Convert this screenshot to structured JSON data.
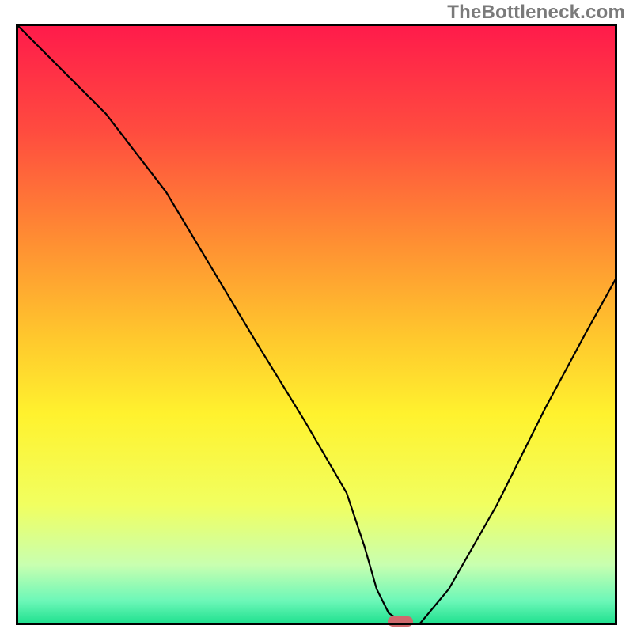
{
  "watermark": "TheBottleneck.com",
  "chart_data": {
    "type": "line",
    "title": "",
    "xlabel": "",
    "ylabel": "",
    "xlim": [
      0,
      100
    ],
    "ylim": [
      0,
      100
    ],
    "grid": false,
    "legend": false,
    "background": {
      "type": "vertical-gradient",
      "stops": [
        {
          "pos": 0,
          "color": "#ff1a4b"
        },
        {
          "pos": 18,
          "color": "#ff4c3f"
        },
        {
          "pos": 35,
          "color": "#ff8a33"
        },
        {
          "pos": 52,
          "color": "#ffc72d"
        },
        {
          "pos": 65,
          "color": "#fff22e"
        },
        {
          "pos": 80,
          "color": "#f1ff60"
        },
        {
          "pos": 90,
          "color": "#c8ffb0"
        },
        {
          "pos": 96,
          "color": "#6cf7b8"
        },
        {
          "pos": 100,
          "color": "#1adf8c"
        }
      ]
    },
    "series": [
      {
        "name": "bottleneck-curve",
        "color": "#000000",
        "x": [
          0,
          7,
          15,
          25,
          31,
          40,
          48,
          55,
          58,
          60,
          62,
          65,
          67,
          72,
          80,
          88,
          95,
          100
        ],
        "values": [
          100,
          93,
          85,
          72,
          62,
          47,
          34,
          22,
          13,
          6,
          2,
          0,
          0,
          6,
          20,
          36,
          49,
          58
        ]
      }
    ],
    "annotations": [
      {
        "name": "optimum-marker",
        "type": "pill",
        "x": 64,
        "y": 0,
        "color": "#cf6a6d"
      }
    ]
  }
}
